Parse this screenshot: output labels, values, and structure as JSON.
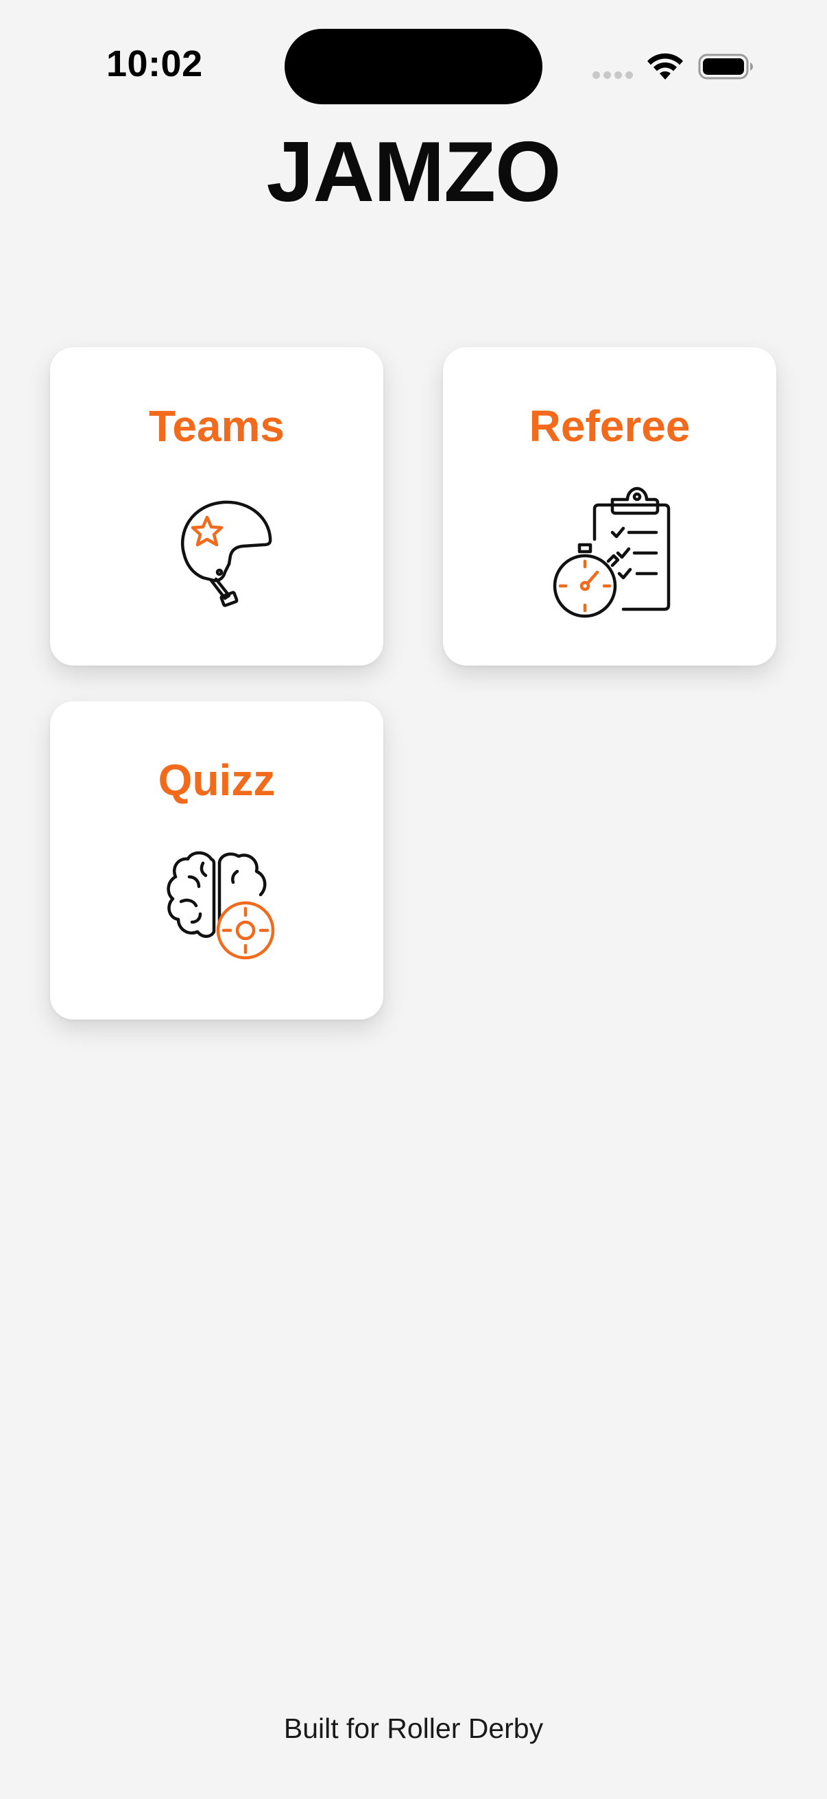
{
  "status_bar": {
    "time": "10:02"
  },
  "app": {
    "title": "JAMZO"
  },
  "cards": {
    "teams": {
      "label": "Teams",
      "icon": "helmet-star-icon"
    },
    "referee": {
      "label": "Referee",
      "icon": "clipboard-stopwatch-icon"
    },
    "quizz": {
      "label": "Quizz",
      "icon": "brain-target-icon"
    }
  },
  "footer": {
    "text": "Built for Roller Derby"
  },
  "colors": {
    "accent": "#f26a1b",
    "background": "#f4f4f4",
    "card": "#ffffff"
  }
}
